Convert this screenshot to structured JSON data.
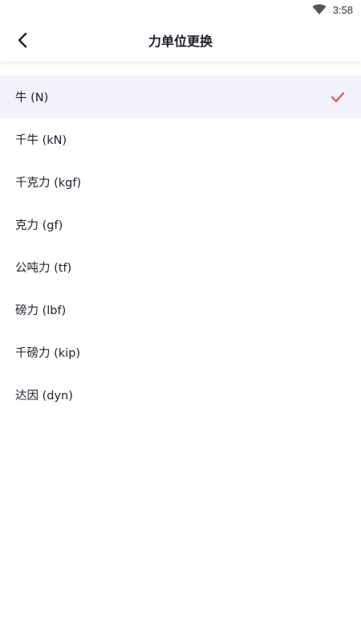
{
  "status": {
    "time": "3:58",
    "wifi_icon": "wifi-icon"
  },
  "header": {
    "title": "力单位更换",
    "back_icon": "chevron-left-icon"
  },
  "units": [
    {
      "label": "牛 (N)",
      "selected": true
    },
    {
      "label": "千牛 (kN)",
      "selected": false
    },
    {
      "label": "千克力 (kgf)",
      "selected": false
    },
    {
      "label": "克力 (gf)",
      "selected": false
    },
    {
      "label": "公吨力 (tf)",
      "selected": false
    },
    {
      "label": "磅力 (lbf)",
      "selected": false
    },
    {
      "label": "千磅力 (kip)",
      "selected": false
    },
    {
      "label": "达因 (dyn)",
      "selected": false
    }
  ],
  "colors": {
    "accent": "#f2545b",
    "selected_bg": "#f2f2fb"
  }
}
